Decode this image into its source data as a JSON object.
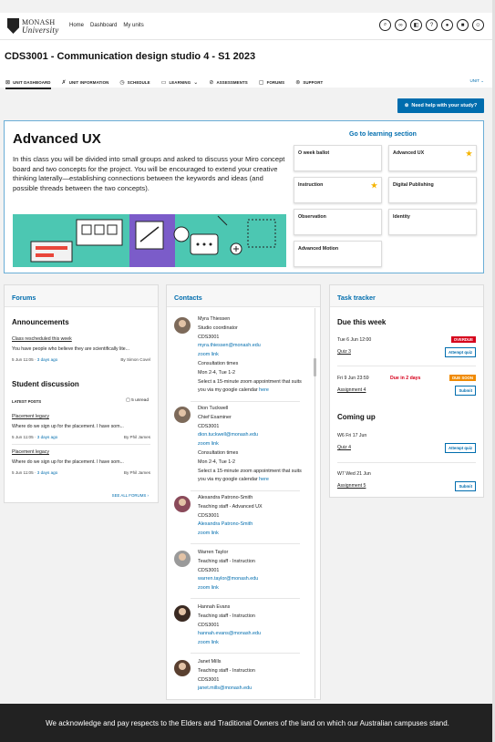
{
  "header": {
    "logo_line1": "MONASH",
    "logo_line2": "University",
    "nav": [
      "Home",
      "Dashboard",
      "My units"
    ]
  },
  "unit": {
    "title": "CDS3001 - Communication design studio 4 - S1 2023",
    "tabs": [
      {
        "label": "UNIT DASHBOARD",
        "icon": "dashboard-icon"
      },
      {
        "label": "UNIT INFORMATION",
        "icon": "info-icon"
      },
      {
        "label": "SCHEDULE",
        "icon": "clock-icon"
      },
      {
        "label": "LEARNING",
        "icon": "book-icon"
      },
      {
        "label": "ASSESSMENTS",
        "icon": "assessment-icon"
      },
      {
        "label": "FORUMS",
        "icon": "chat-icon"
      },
      {
        "label": "SUPPORT",
        "icon": "support-icon"
      }
    ],
    "toggle": "UNIT"
  },
  "help_button": "Need help with your study?",
  "learning": {
    "heading": "Advanced UX",
    "description": "In this class you will be divided into small groups and asked to discuss your Miro concept board and two concepts for the project. You will be encouraged to extend your creative thinking laterally—establishing connections between the keywords and ideas (and possible threads between the two concepts).",
    "goto_label": "Go to learning section",
    "cards": [
      {
        "label": "O week ballot",
        "starred": false
      },
      {
        "label": "Advanced UX",
        "starred": true
      },
      {
        "label": "Instruction",
        "starred": true
      },
      {
        "label": "Digital Publishing",
        "starred": false
      },
      {
        "label": "Observation",
        "starred": false
      },
      {
        "label": "Identity",
        "starred": false
      },
      {
        "label": "Advanced Motion",
        "starred": false
      }
    ]
  },
  "forums": {
    "title": "Forums",
    "announcements_heading": "Announcements",
    "announcement": {
      "title": "Class rescheduled this week",
      "excerpt": "You have people who believe they are scientifically lite...",
      "date": "5 Jun 11:05",
      "ago": "3 days ago",
      "author": "By Simon Covel"
    },
    "discussion_heading": "Student discussion",
    "latest_posts_label": "LATEST POSTS",
    "unread": "5 unread",
    "posts": [
      {
        "title": "Placement legacy",
        "excerpt": "Where do we sign up for the placement. I have som...",
        "date": "5 Jun 11:05",
        "ago": "3 days ago",
        "author": "By Phil James"
      },
      {
        "title": "Placement legacy",
        "excerpt": "Where do we sign up for the placement. I have som...",
        "date": "5 Jun 11:05",
        "ago": "3 days ago",
        "author": "By Phil James"
      }
    ],
    "see_all": "SEE ALL FORUMS"
  },
  "contacts": {
    "title": "Contacts",
    "people": [
      {
        "name": "Myra Thiessen",
        "role": "Studio coordinator",
        "unit": "CDS3001",
        "email": "myra.thiessen@monash.edu",
        "zoom": "zoom link",
        "extra_title": "Consultation times",
        "times": "Mon 2-4, Tue 1-2",
        "note": "Select a 15-minute zoom appointment that suits you via my google calendar",
        "note_link": "here"
      },
      {
        "name": "Dion Tuckwell",
        "role": "Chief Examiner",
        "unit": "CDS3001",
        "email": "dion.tuckwell@monash.edu",
        "zoom": "zoom link",
        "extra_title": "Consultation times",
        "times": "Mon 2-4, Tue 1-2",
        "note": "Select a 15-minute zoom appointment that suits you via my google calendar",
        "note_link": "here"
      },
      {
        "name": "Alexandra Patrono-Smith",
        "role": "Teaching staff - Advanced UX",
        "unit": "CDS3001",
        "email": "Alexandra Patrono-Smith",
        "zoom": "zoom link"
      },
      {
        "name": "Warren Taylor",
        "role": "Teaching staff - Instruction",
        "unit": "CDS3001",
        "email": "warren.taylor@monash.edu",
        "zoom": "zoom link"
      },
      {
        "name": "Hannah Evans",
        "role": "Teaching staff - Instruction",
        "unit": "CDS3001",
        "email": "hannah.evans@monash.edu",
        "zoom": "zoom link"
      },
      {
        "name": "Janet Mills",
        "role": "Teaching staff - Instruction",
        "unit": "CDS3001",
        "email": "janet.mills@monash.edu"
      }
    ]
  },
  "tasks": {
    "title": "Task tracker",
    "due_heading": "Due this week",
    "coming_heading": "Coming up",
    "due": [
      {
        "date": "Tue 6 Jun 12:00",
        "badge": "OVERDUE",
        "badge_color": "#d6001c",
        "name": "Quiz 3",
        "action": "Attempt quiz"
      },
      {
        "date": "Fri 9 Jun 23:59",
        "due_in": "Due in 2 days",
        "badge": "DUE SOON",
        "badge_color": "#f08a00",
        "name": "Assignment 4",
        "action": "Submit"
      }
    ],
    "coming": [
      {
        "date": "W6 Fri 17 Jun",
        "name": "Quiz 4",
        "action": "Attempt quiz"
      },
      {
        "date": "W7 Wed 21 Jun",
        "name": "Assignment 5",
        "action": "Submit"
      }
    ]
  },
  "footer": "We acknowledge and pay respects to the Elders and Traditional Owners of the land on which our Australian campuses stand.",
  "colors": {
    "accent": "#006dae",
    "overdue": "#d6001c",
    "due_soon": "#f08a00",
    "star": "#f5b400",
    "footer_bg": "#222222",
    "illustration_bg": "#4cc7b2"
  }
}
